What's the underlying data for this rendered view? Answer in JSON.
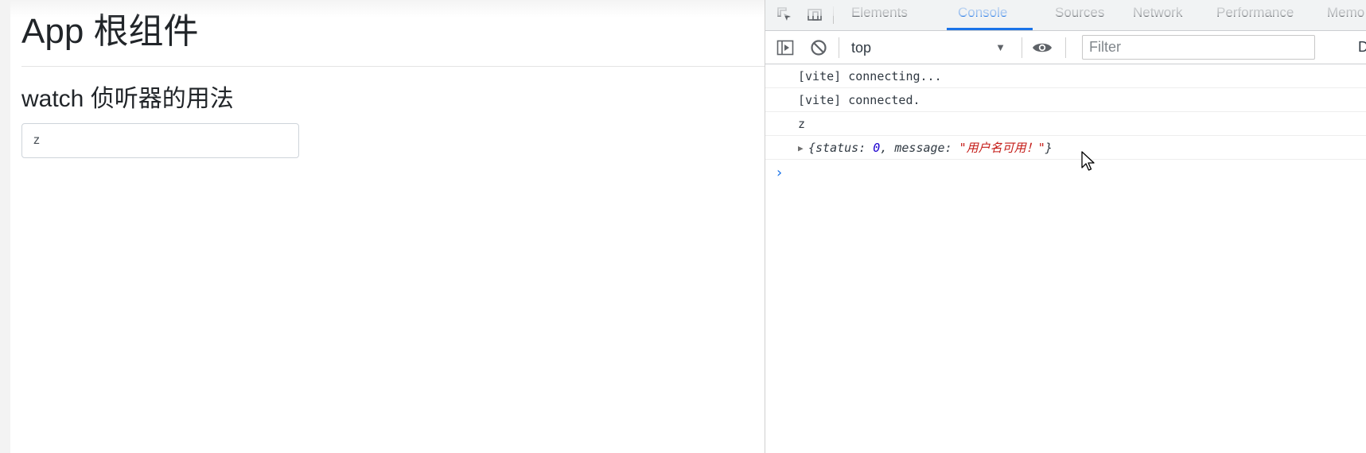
{
  "app": {
    "title": "App 根组件",
    "subtitle": "watch 侦听器的用法",
    "input_value": "z"
  },
  "devtools": {
    "tabs": [
      {
        "label": "Elements"
      },
      {
        "label": "Console"
      },
      {
        "label": "Sources"
      },
      {
        "label": "Network"
      },
      {
        "label": "Performance"
      },
      {
        "label": "Memo"
      }
    ],
    "active_tab": "Console",
    "toolbar": {
      "context": "top",
      "filter_placeholder": "Filter",
      "trailing_label": "D"
    },
    "console": {
      "messages": [
        {
          "text": "[vite] connecting..."
        },
        {
          "text": "[vite] connected."
        },
        {
          "text": "z"
        }
      ],
      "object": {
        "open": "{",
        "k1": "status: ",
        "v1": "0",
        "sep": ", ",
        "k2": "message: ",
        "v2": "\"用户名可用！\"",
        "close": "}"
      },
      "prompt": "›"
    }
  },
  "colors": {
    "accent": "#1a73e8",
    "string": "#c41a16",
    "number": "#1c00cf"
  }
}
